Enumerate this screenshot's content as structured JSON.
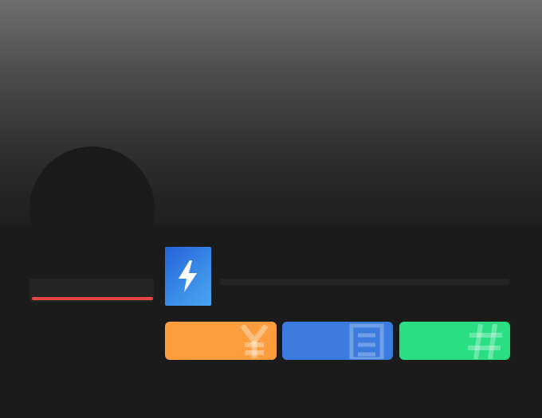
{
  "profile": {
    "cover_colors": [
      "#6f6f6f",
      "#1e1e1e"
    ],
    "name_underline_color": "#e74543"
  },
  "badge": {
    "icon": "lightning-bolt-icon",
    "colors": [
      "#2563d9",
      "#4aa3f2"
    ]
  },
  "stats": [
    {
      "icon": "yen-icon",
      "color": "#fd9d3d"
    },
    {
      "icon": "document-icon",
      "color": "#3b7bde"
    },
    {
      "icon": "hashtag-icon",
      "color": "#2ade84"
    }
  ]
}
